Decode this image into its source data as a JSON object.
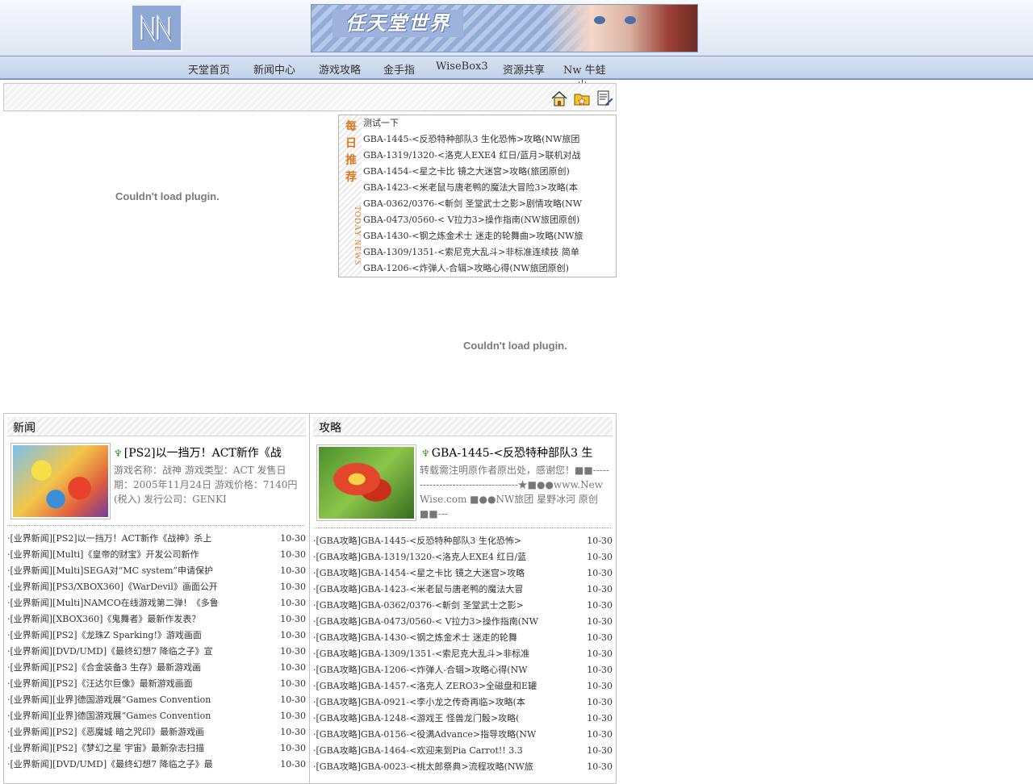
{
  "header": {
    "logo_text": "NN",
    "banner_title": "任天堂世界"
  },
  "nav": {
    "items": [
      "天堂首页",
      "新闻中心",
      "游戏攻略",
      "金手指",
      "WiseBox3",
      "资源共享",
      "Nw 牛蛙"
    ],
    "cursor": "山"
  },
  "toolbar": {
    "icons": [
      "home-icon",
      "favorite-icon",
      "document-edit-icon"
    ]
  },
  "plugins": {
    "message": "Couldn't load plugin."
  },
  "recommend": {
    "vertical_title": [
      "每",
      "日",
      "推",
      "荐"
    ],
    "today_label": "TODAY NEWS",
    "items": [
      "测试一下",
      "GBA-1445-<反恐特种部队3 生化恐怖>攻略(NW旅团",
      "GBA-1319/1320-<洛克人EXE4 红日/蓝月>联机对战",
      "GBA-1454-<星之卡比 镜之大迷宫>攻略(旅团原创)",
      "GBA-1423-<米老鼠与唐老鸭的魔法大冒险3>攻略(本",
      "GBA-0362/0376-<斬剑 圣堂武士之影>剧情攻略(NW",
      "GBA-0473/0560-< V拉力3>操作指南(NW旅团原创)",
      "GBA-1430-<钢之炼金术士 迷走的轮舞曲>攻略(NW旅",
      "GBA-1309/1351-<索尼克大乱斗>非标准连续技 简单",
      "GBA-1206-<炸弹人-合辑>攻略心得(NW旅团原创)"
    ]
  },
  "news": {
    "title": "新闻",
    "featured_title": "[PS2]以一挡万！ACT新作《战",
    "featured_desc": "游戏名称：战神 游戏类型：ACT 发售日期：2005年11月24日 游戏价格：7140円(税入) 发行公司：GENKI",
    "items": [
      {
        "text": "·[业界新闻][PS2]以一挡万！ACT新作《战神》杀上",
        "date": "10-30"
      },
      {
        "text": "·[业界新闻][Multi]《皇帝的财宝》开发公司新作",
        "date": "10-30"
      },
      {
        "text": "·[业界新闻][Multi]SEGA对“MC system”申请保护",
        "date": "10-30"
      },
      {
        "text": "·[业界新闻][PS3/XBOX360]《WarDevil》画面公开",
        "date": "10-30"
      },
      {
        "text": "·[业界新闻][Multi]NAMCO在线游戏第二弹！《多鲁",
        "date": "10-30"
      },
      {
        "text": "·[业界新闻][XBOX360]《鬼舞者》最新作发表？",
        "date": "10-30"
      },
      {
        "text": "·[业界新闻][PS2]《龙珠Z Sparking!》游戏画面",
        "date": "10-30"
      },
      {
        "text": "·[业界新闻][DVD/UMD]《最终幻想7 降临之子》宣",
        "date": "10-30"
      },
      {
        "text": "·[业界新闻][PS2]《合金装备3 生存》最新游戏画",
        "date": "10-30"
      },
      {
        "text": "·[业界新闻][PS2]《汪达尔巨像》最新游戏画面",
        "date": "10-30"
      },
      {
        "text": "·[业界新闻][业界]德国游戏展“Games Convention",
        "date": "10-30"
      },
      {
        "text": "·[业界新闻][业界]德国游戏展“Games Convention",
        "date": "10-30"
      },
      {
        "text": "·[业界新闻][PS2]《恶魔城 暗之咒印》最新游戏画",
        "date": "10-30"
      },
      {
        "text": "·[业界新闻][PS2]《梦幻之星 宇宙》最新杂志扫描",
        "date": "10-30"
      },
      {
        "text": "·[业界新闻][DVD/UMD]《最终幻想7 降临之子》最",
        "date": "10-30"
      }
    ]
  },
  "guide": {
    "title": "攻略",
    "featured_title": "GBA-1445-<反恐特种部队3 生",
    "featured_desc": "转载需注明原作者原出处，感谢您！■■-----------------------------------★■●●www.NewWise.com ■●●NW旅团 星野冰河 原创 ■■---",
    "items": [
      {
        "text": "·[GBA攻略]GBA-1445-<反恐特种部队3 生化恐怖>",
        "date": "10-30"
      },
      {
        "text": "·[GBA攻略]GBA-1319/1320-<洛克人EXE4 红日/蓝",
        "date": "10-30"
      },
      {
        "text": "·[GBA攻略]GBA-1454-<星之卡比 镜之大迷宫>攻略",
        "date": "10-30"
      },
      {
        "text": "·[GBA攻略]GBA-1423-<米老鼠与唐老鸭的魔法大冒",
        "date": "10-30"
      },
      {
        "text": "·[GBA攻略]GBA-0362/0376-<斬剑 圣堂武士之影>",
        "date": "10-30"
      },
      {
        "text": "·[GBA攻略]GBA-0473/0560-< V拉力3>操作指南(NW",
        "date": "10-30"
      },
      {
        "text": "·[GBA攻略]GBA-1430-<钢之炼金术士 迷走的轮舞",
        "date": "10-30"
      },
      {
        "text": "·[GBA攻略]GBA-1309/1351-<索尼克大乱斗>非标准",
        "date": "10-30"
      },
      {
        "text": "·[GBA攻略]GBA-1206-<炸弹人-合辑>攻略心得(NW",
        "date": "10-30"
      },
      {
        "text": "·[GBA攻略]GBA-1457-<洛克人 ZERO3>全磁盘和E罐",
        "date": "10-30"
      },
      {
        "text": "·[GBA攻略]GBA-0921-<李小龙之传奇再临>攻略(本",
        "date": "10-30"
      },
      {
        "text": "·[GBA攻略]GBA-1248-<游戏王 怪兽龙门骰>攻略(",
        "date": "10-30"
      },
      {
        "text": "·[GBA攻略]GBA-0156-<役满Advance>指导攻略(NW",
        "date": "10-30"
      },
      {
        "text": "·[GBA攻略]GBA-1464-<欢迎来到Pia Carrot!! 3.3",
        "date": "10-30"
      },
      {
        "text": "·[GBA攻略]GBA-0023-<桃太郎祭典>流程攻略(NW旅",
        "date": "10-30"
      }
    ]
  }
}
